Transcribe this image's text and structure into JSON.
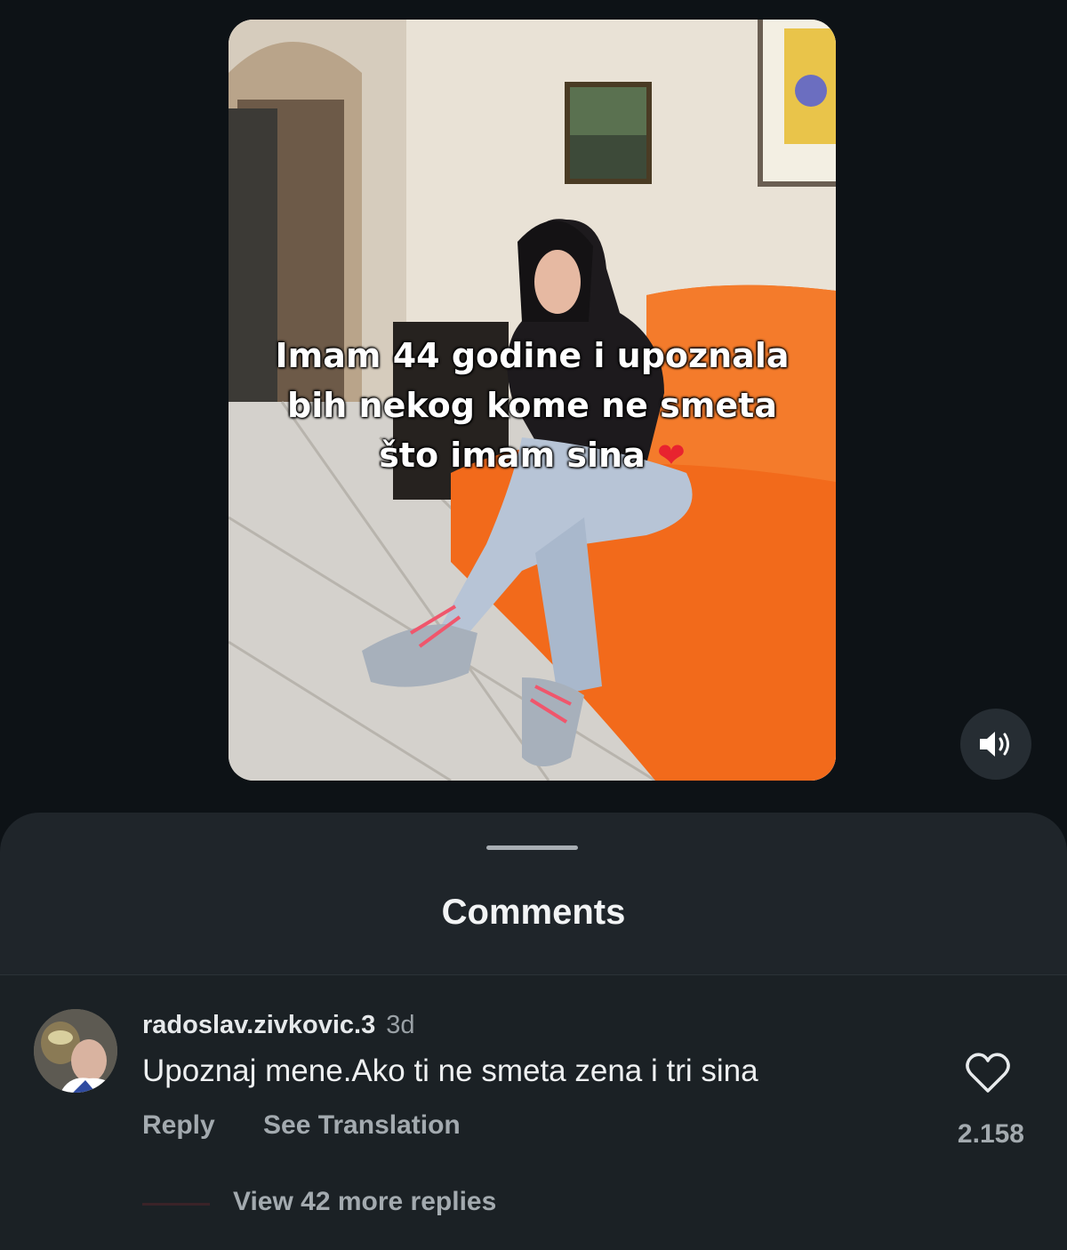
{
  "video": {
    "caption_line1": "Imam 44 godine i upoznala",
    "caption_line2": "bih nekog kome ne smeta",
    "caption_line3": "što imam sina",
    "caption_emoji": "❤",
    "mute_icon": "speaker-icon"
  },
  "comments_sheet": {
    "title": "Comments",
    "comment": {
      "username": "radoslav.zivkovic.3",
      "time": "3d",
      "text": "Upoznaj mene.Ako ti ne smeta zena i tri sina",
      "reply_label": "Reply",
      "translation_label": "See Translation",
      "like_count": "2.158",
      "like_icon": "heart-outline-icon",
      "view_replies_label": "View 42 more replies"
    }
  },
  "colors": {
    "background": "#0d1216",
    "sheet": "#1f252a",
    "sofa": "#f26a1b",
    "heart": "#e8232f"
  }
}
